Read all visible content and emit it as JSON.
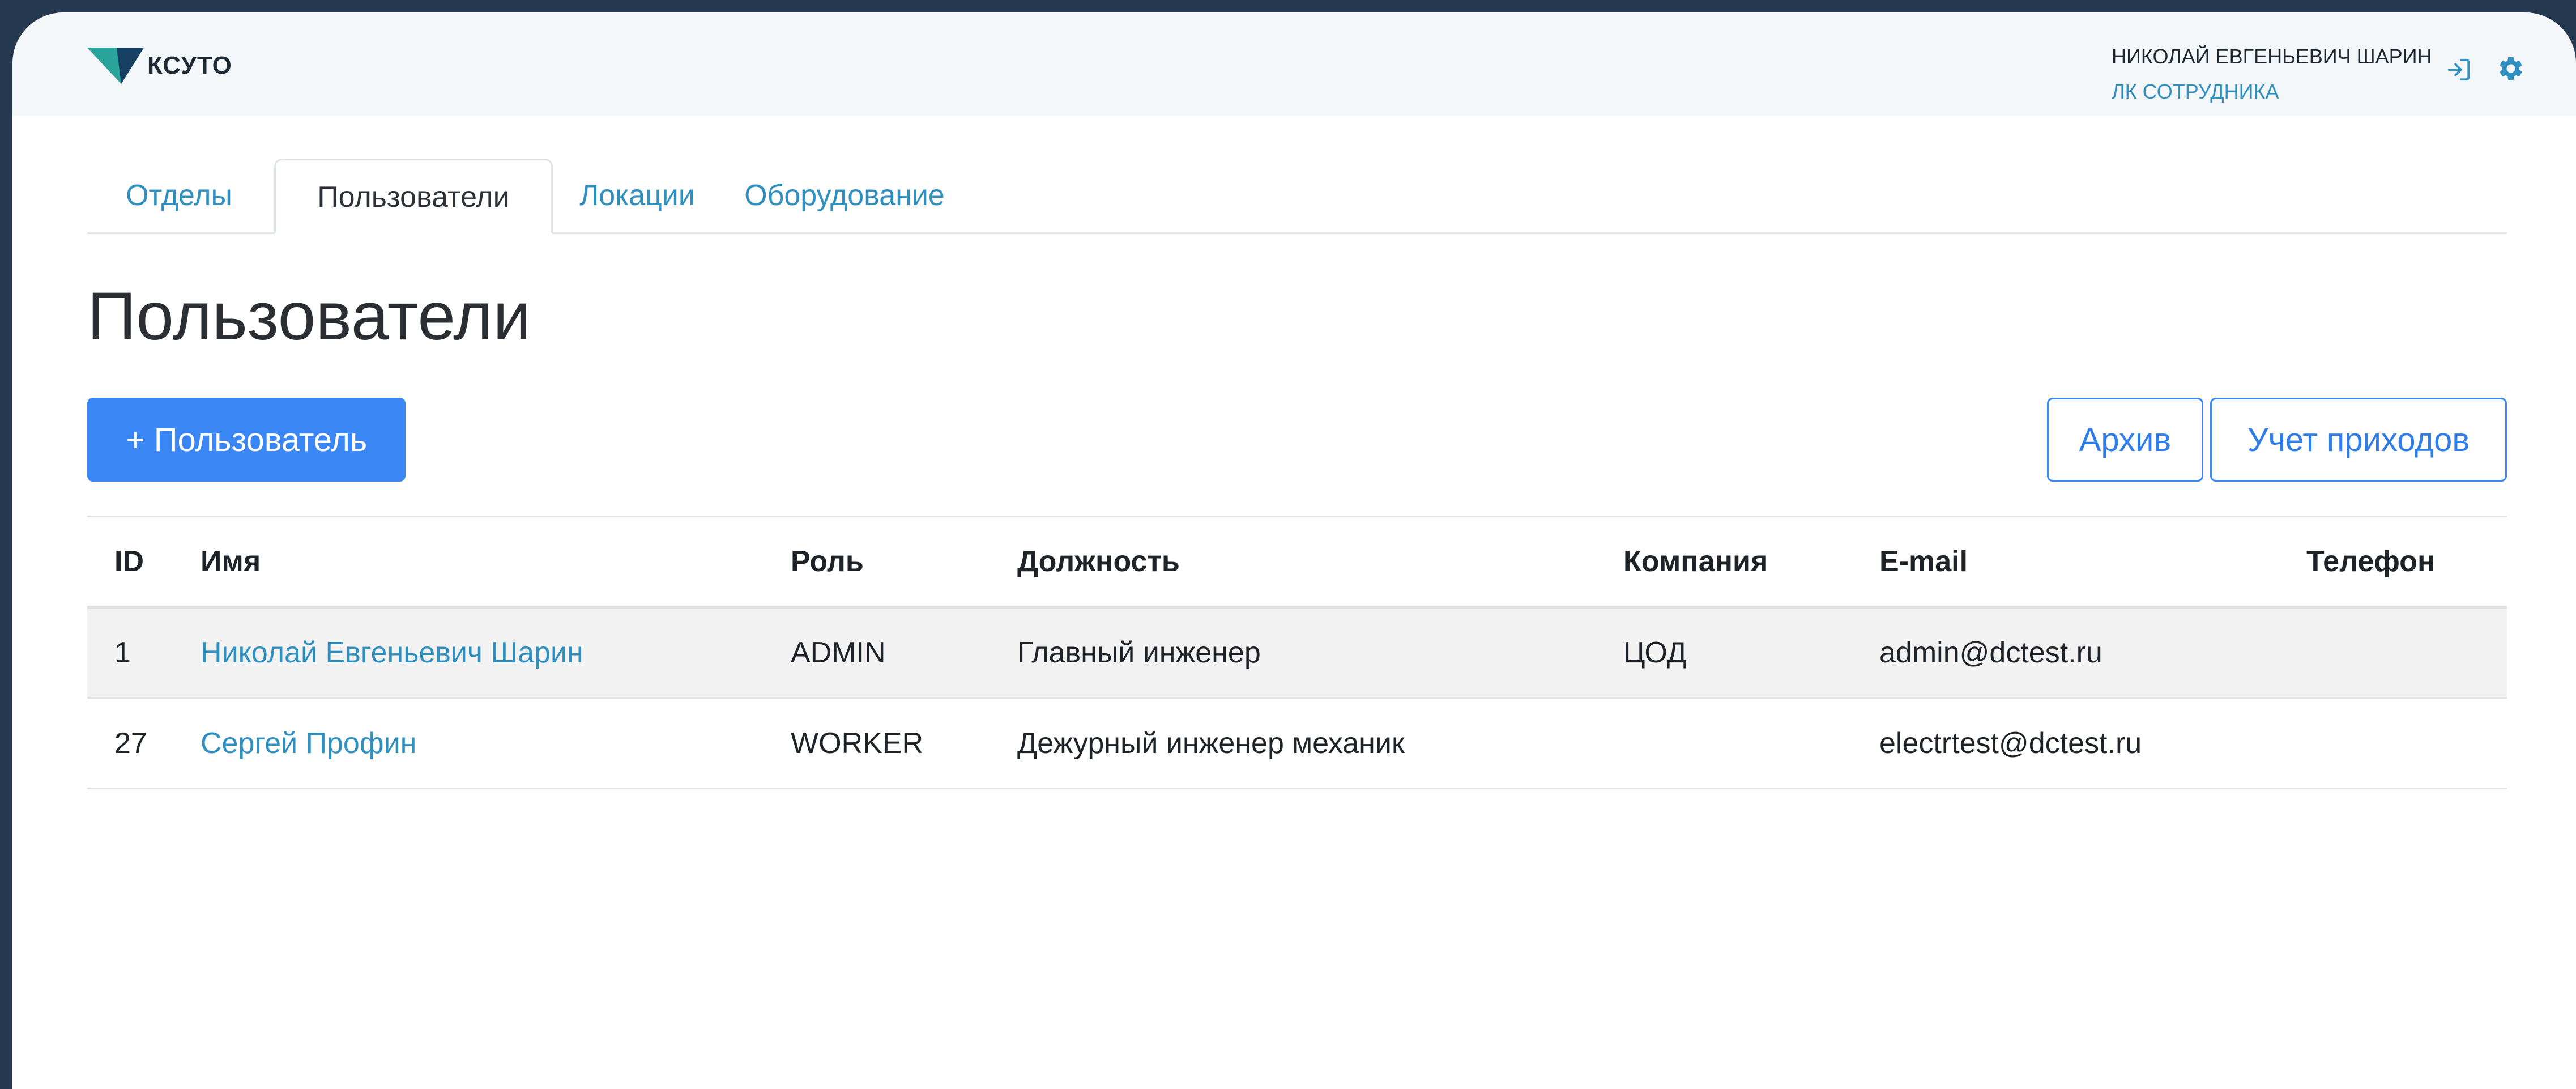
{
  "header": {
    "logo_text": "КСУТО",
    "user_name": "НИКОЛАЙ ЕВГЕНЬЕВИЧ ШАРИН",
    "user_cabinet": "ЛК СОТРУДНИКА",
    "icons": [
      "logout-icon",
      "gear-icon"
    ]
  },
  "tabs": [
    {
      "label": "Отделы",
      "active": false
    },
    {
      "label": "Пользователи",
      "active": true
    },
    {
      "label": "Локации",
      "active": false
    },
    {
      "label": "Оборудование",
      "active": false
    }
  ],
  "page": {
    "title": "Пользователи"
  },
  "toolbar": {
    "add_user_label": "+ Пользователь",
    "archive_label": "Архив",
    "income_label": "Учет приходов"
  },
  "colors": {
    "primary": "#3a86f4",
    "link": "#2f8fbf",
    "header_bg": "#f4f7fa",
    "frame": "#24384f"
  },
  "table": {
    "columns": [
      "ID",
      "Имя",
      "Роль",
      "Должность",
      "Компания",
      "E-mail",
      "Телефон"
    ],
    "rows": [
      {
        "id": "1",
        "name": "Николай Евгеньевич Шарин",
        "role": "ADMIN",
        "position": "Главный инженер",
        "company": "ЦОД",
        "email": "admin@dctest.ru",
        "phone": ""
      },
      {
        "id": "27",
        "name": "Сергей Профин",
        "role": "WORKER",
        "position": "Дежурный инженер механик",
        "company": "",
        "email": "electrtest@dctest.ru",
        "phone": ""
      }
    ]
  }
}
